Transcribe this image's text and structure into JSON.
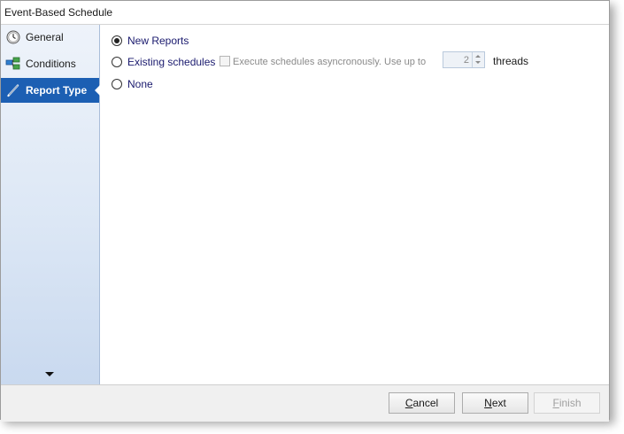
{
  "window": {
    "title": "Event-Based Schedule"
  },
  "sidebar": {
    "items": [
      {
        "label": "General",
        "icon": "clock-icon",
        "active": false
      },
      {
        "label": "Conditions",
        "icon": "conditions-icon",
        "active": false
      },
      {
        "label": "Report Type",
        "icon": "pen-icon",
        "active": true
      }
    ],
    "more_icon": "chevron-down-icon"
  },
  "content": {
    "options": [
      {
        "label": "New Reports",
        "checked": true
      },
      {
        "label": "Existing schedules",
        "checked": false
      },
      {
        "label": "None",
        "checked": false
      }
    ],
    "async_checkbox": {
      "label": "Execute schedules asyncronously. Use up to",
      "checked": false,
      "enabled": false
    },
    "threads": {
      "value": "2",
      "label": "threads"
    }
  },
  "footer": {
    "cancel_first": "C",
    "cancel_rest": "ancel",
    "next_first": "N",
    "next_rest": "ext",
    "finish_first": "F",
    "finish_rest": "inish"
  },
  "colors": {
    "accent": "#1c5fb3",
    "sidebar_top": "#eef3fa",
    "sidebar_bottom": "#c9d9ef"
  }
}
